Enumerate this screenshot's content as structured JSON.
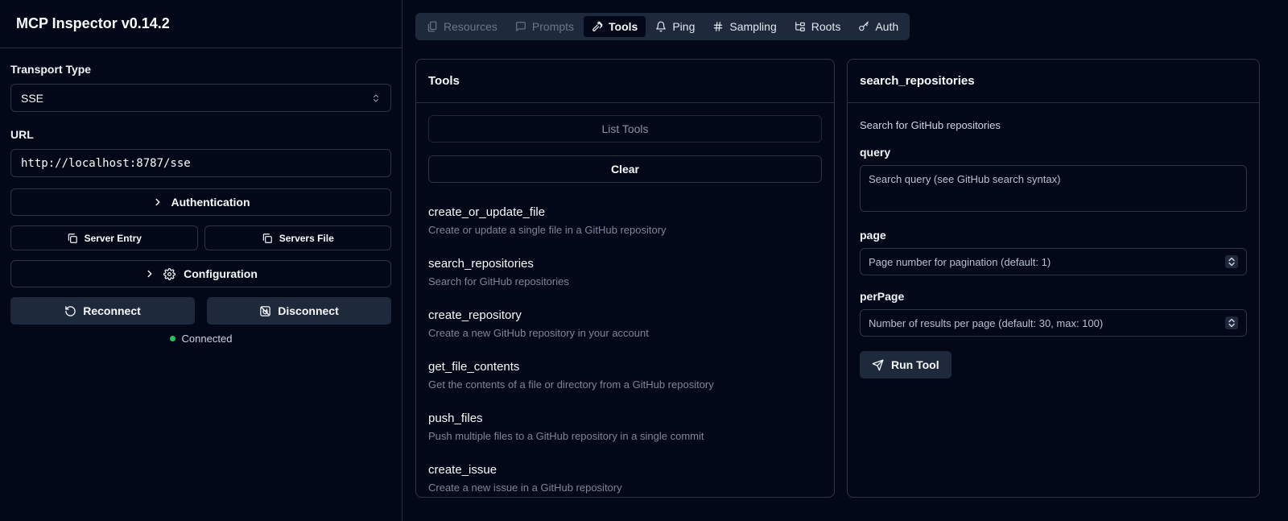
{
  "app": {
    "title": "MCP Inspector v0.14.2"
  },
  "sidebar": {
    "transport_label": "Transport Type",
    "transport_value": "SSE",
    "url_label": "URL",
    "url_value": "http://localhost:8787/sse",
    "authentication_label": "Authentication",
    "server_entry_label": "Server Entry",
    "servers_file_label": "Servers File",
    "configuration_label": "Configuration",
    "reconnect_label": "Reconnect",
    "disconnect_label": "Disconnect",
    "status_text": "Connected",
    "status_color": "#22c55e"
  },
  "tabs": [
    {
      "label": "Resources",
      "icon": "files-icon"
    },
    {
      "label": "Prompts",
      "icon": "message-icon"
    },
    {
      "label": "Tools",
      "icon": "hammer-icon"
    },
    {
      "label": "Ping",
      "icon": "bell-icon"
    },
    {
      "label": "Sampling",
      "icon": "hash-icon"
    },
    {
      "label": "Roots",
      "icon": "folder-tree-icon"
    },
    {
      "label": "Auth",
      "icon": "key-icon"
    }
  ],
  "tools_panel": {
    "title": "Tools",
    "list_tools_label": "List Tools",
    "clear_label": "Clear",
    "items": [
      {
        "name": "create_or_update_file",
        "description": "Create or update a single file in a GitHub repository"
      },
      {
        "name": "search_repositories",
        "description": "Search for GitHub repositories"
      },
      {
        "name": "create_repository",
        "description": "Create a new GitHub repository in your account"
      },
      {
        "name": "get_file_contents",
        "description": "Get the contents of a file or directory from a GitHub repository"
      },
      {
        "name": "push_files",
        "description": "Push multiple files to a GitHub repository in a single commit"
      },
      {
        "name": "create_issue",
        "description": "Create a new issue in a GitHub repository"
      }
    ]
  },
  "detail_panel": {
    "title": "search_repositories",
    "description": "Search for GitHub repositories",
    "params": {
      "query": {
        "label": "query",
        "placeholder": "Search query (see GitHub search syntax)"
      },
      "page": {
        "label": "page",
        "placeholder": "Page number for pagination (default: 1)"
      },
      "perPage": {
        "label": "perPage",
        "placeholder": "Number of results per page (default: 30, max: 100)"
      }
    },
    "run_label": "Run Tool"
  }
}
